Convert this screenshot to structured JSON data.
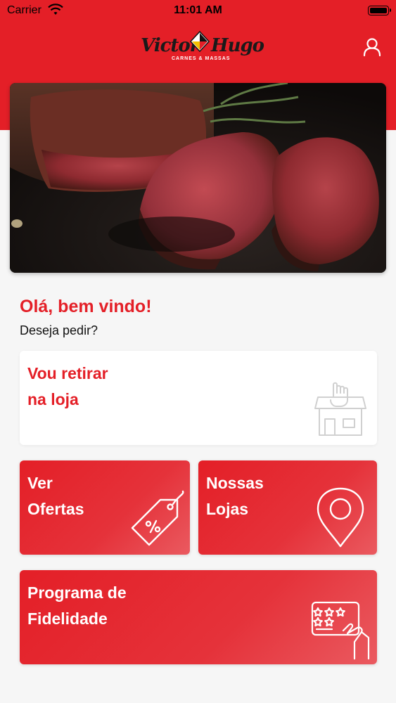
{
  "status_bar": {
    "carrier": "Carrier",
    "time": "11:01 AM"
  },
  "header": {
    "logo": {
      "word1": "Victor",
      "word2": "Hugo",
      "tagline": "CARNES & MASSAS"
    }
  },
  "colors": {
    "brand_red": "#e41f27",
    "background": "#f6f6f6",
    "card_white": "#ffffff"
  },
  "greeting": {
    "title": "Olá, bem vindo!",
    "subtitle": "Deseja pedir?"
  },
  "options": {
    "pickup": {
      "label": "Vou retirar\nna loja",
      "icon": "store-pickup-icon"
    },
    "offers": {
      "label": "Ver\nOfertas",
      "icon": "price-tag-icon"
    },
    "stores": {
      "label": "Nossas\nLojas",
      "icon": "location-pin-icon"
    },
    "loyalty": {
      "label": "Programa de\nFidelidade",
      "icon": "loyalty-card-icon"
    }
  }
}
